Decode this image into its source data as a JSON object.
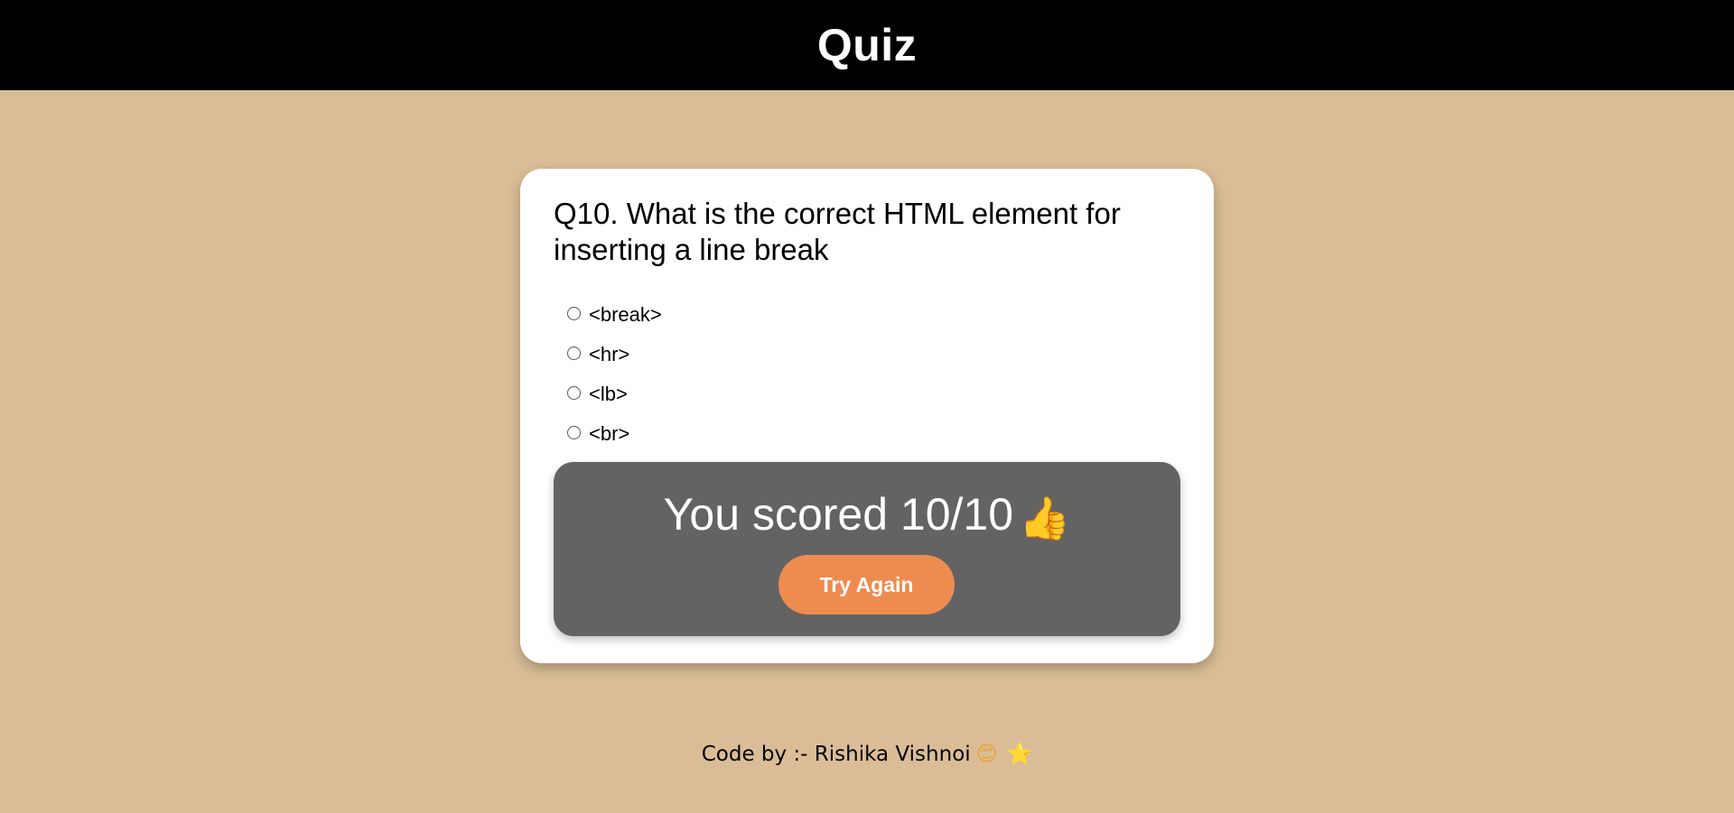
{
  "header": {
    "title": "Quiz"
  },
  "quiz": {
    "question": "Q10. What is the correct HTML element for inserting a line break",
    "options": [
      "<break>",
      "<hr>",
      "<lb>",
      "<br>"
    ]
  },
  "result": {
    "score_text": "You scored 10/10",
    "score_icon": "thumbs-up",
    "try_again_label": "Try Again"
  },
  "footer": {
    "credit": "Code by :- Rishika Vishnoi",
    "icons": [
      "smile-emoji",
      "star-emoji"
    ]
  },
  "colors": {
    "background": "#dabd96",
    "header_bg": "#000000",
    "result_bg": "#636363",
    "button_bg": "#ee8c50"
  }
}
